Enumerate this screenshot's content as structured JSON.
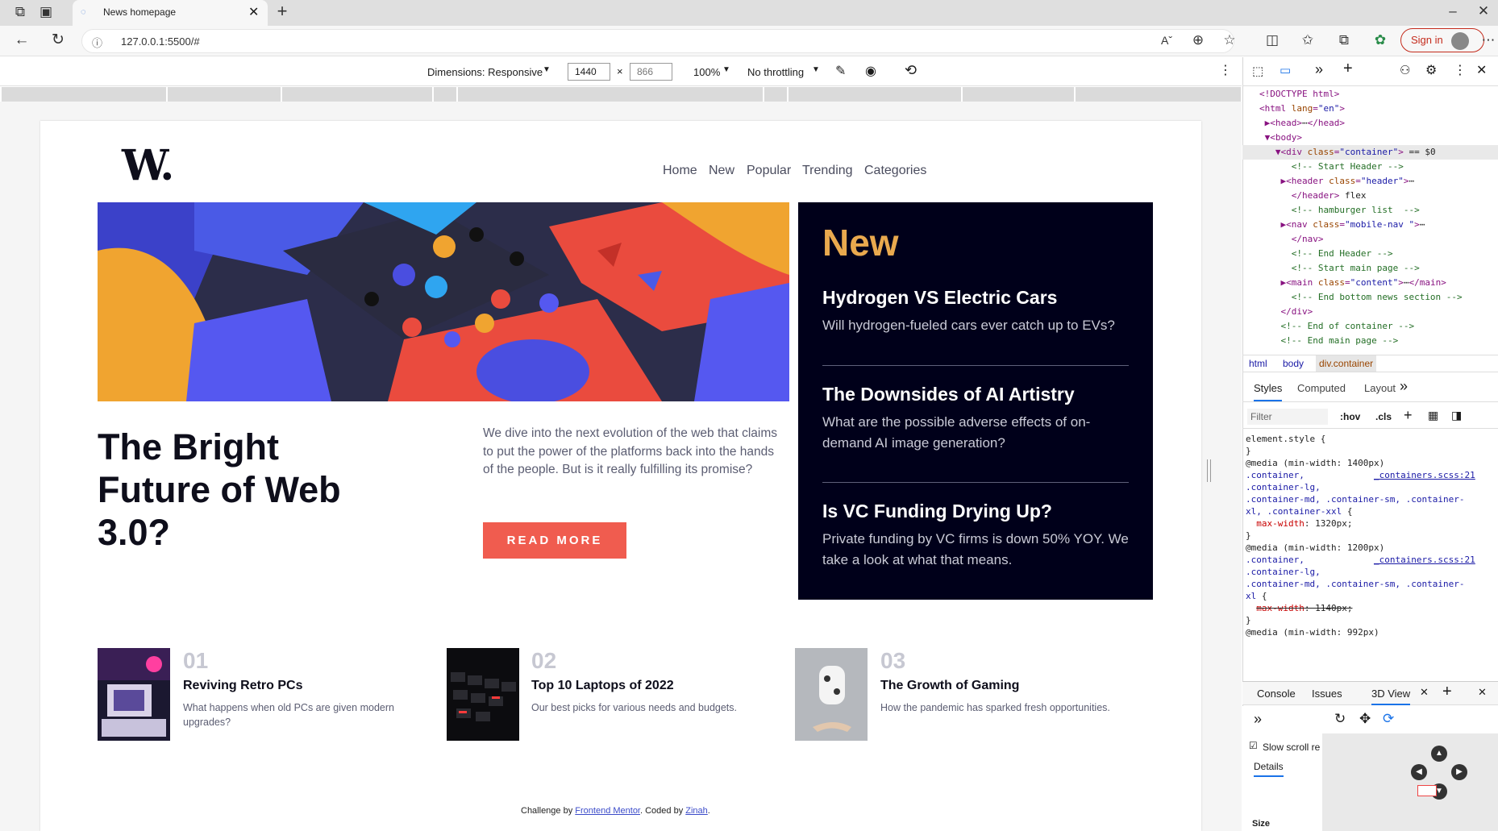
{
  "browser": {
    "tab_title": "News homepage",
    "url": "127.0.0.1:5500/#",
    "sign_in": "Sign in"
  },
  "device_toolbar": {
    "dimensions": "Dimensions: Responsive",
    "width": "1440",
    "height": "866",
    "zoom": "100%",
    "throttling": "No throttling"
  },
  "page": {
    "logo": "W.",
    "nav": [
      "Home",
      "New",
      "Popular",
      "Trending",
      "Categories"
    ],
    "headline": "The Bright Future of Web 3.0?",
    "intro": "We dive into the next evolution of the web that claims to put the power of the platforms back into the hands of the people. But is it really fulfilling its promise?",
    "read_more": "READ MORE",
    "new_section": {
      "title": "New",
      "items": [
        {
          "title": "Hydrogen VS Electric Cars",
          "desc": "Will hydrogen-fueled cars ever catch up to EVs?"
        },
        {
          "title": "The Downsides of AI Artistry",
          "desc": "What are the possible adverse effects of on-demand AI image generation?"
        },
        {
          "title": "Is VC Funding Drying Up?",
          "desc": "Private funding by VC firms is down 50% YOY. We take a look at what that means."
        }
      ]
    },
    "cards": [
      {
        "num": "01",
        "title": "Reviving Retro PCs",
        "desc": "What happens when old PCs are given modern upgrades?"
      },
      {
        "num": "02",
        "title": "Top 10 Laptops of 2022",
        "desc": "Our best picks for various needs and budgets."
      },
      {
        "num": "03",
        "title": "The Growth of Gaming",
        "desc": "How the pandemic has sparked fresh opportunities."
      }
    ],
    "footer": {
      "pre": "Challenge by ",
      "link1": "Frontend Mentor",
      "mid": ". Coded by ",
      "link2": "Zinah",
      "post": "."
    }
  },
  "devtools": {
    "breadcrumbs": [
      "html",
      "body",
      "div.container"
    ],
    "style_tabs": [
      "Styles",
      "Computed",
      "Layout"
    ],
    "filter_placeholder": "Filter",
    "hov": ":hov",
    "cls": ".cls",
    "drawer_tabs": [
      "Console",
      "Issues",
      "3D View"
    ],
    "slow_scroll": "Slow scroll re",
    "details": "Details",
    "size": "Size"
  }
}
